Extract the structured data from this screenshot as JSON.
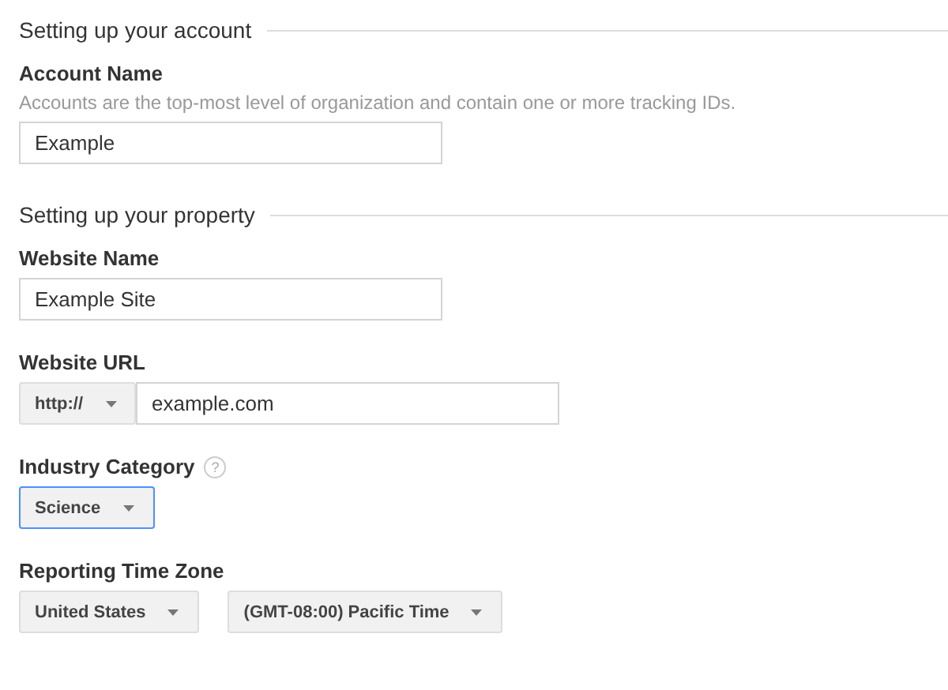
{
  "sections": [
    {
      "title": "Setting up your account",
      "fields": [
        {
          "kind": "text",
          "label": "Account Name",
          "description": "Accounts are the top-most level of organization and contain one or more tracking IDs.",
          "value": "Example"
        }
      ]
    },
    {
      "title": "Setting up your property",
      "fields": [
        {
          "kind": "text",
          "label": "Website Name",
          "value": "Example Site"
        },
        {
          "kind": "url",
          "label": "Website URL",
          "prefix": "http://",
          "value": "example.com"
        },
        {
          "kind": "select",
          "label": "Industry Category",
          "help": "?",
          "selects": [
            {
              "value": "Science",
              "focused": true
            }
          ]
        },
        {
          "kind": "select",
          "label": "Reporting Time Zone",
          "selects": [
            {
              "value": "United States",
              "focused": false
            },
            {
              "value": "(GMT-08:00) Pacific Time",
              "focused": false
            }
          ]
        }
      ]
    }
  ]
}
